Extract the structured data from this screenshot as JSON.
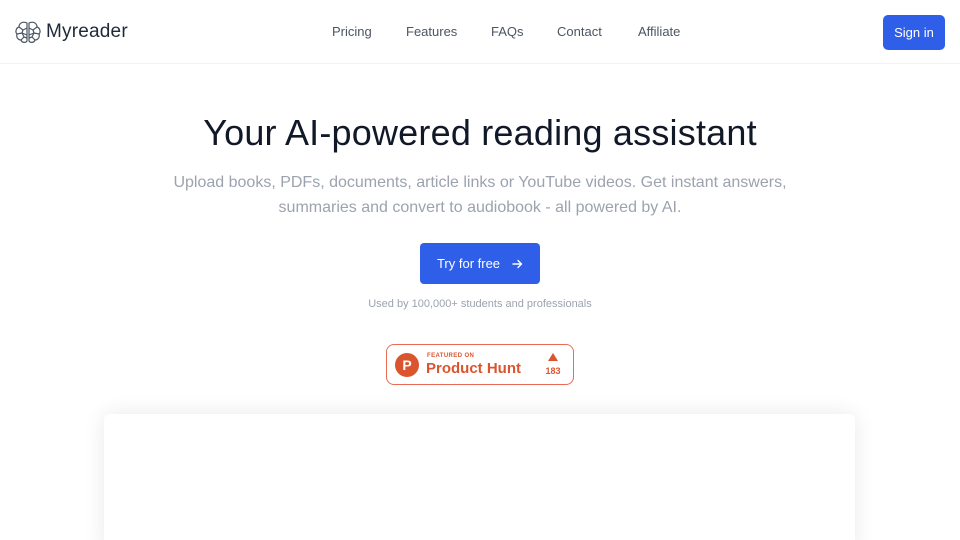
{
  "header": {
    "logo_text": "Myreader",
    "logo_icon": "brain-icon",
    "nav": [
      "Pricing",
      "Features",
      "FAQs",
      "Contact",
      "Affiliate"
    ],
    "sign_in_label": "Sign in"
  },
  "hero": {
    "title": "Your AI-powered reading assistant",
    "subtitle": "Upload books, PDFs, documents, article links or YouTube videos. Get instant answers, summaries and convert to audiobook - all powered by AI.",
    "cta_label": "Try for free",
    "cta_icon": "arrow-right-icon",
    "used_by": "Used by 100,000+ students and professionals"
  },
  "product_hunt": {
    "featured_label": "FEATURED ON",
    "name": "Product Hunt",
    "logo_letter": "P",
    "upvotes": "183"
  },
  "colors": {
    "accent": "#2f5ee8",
    "product_hunt": "#da552f",
    "muted_text": "#9ca3af"
  }
}
